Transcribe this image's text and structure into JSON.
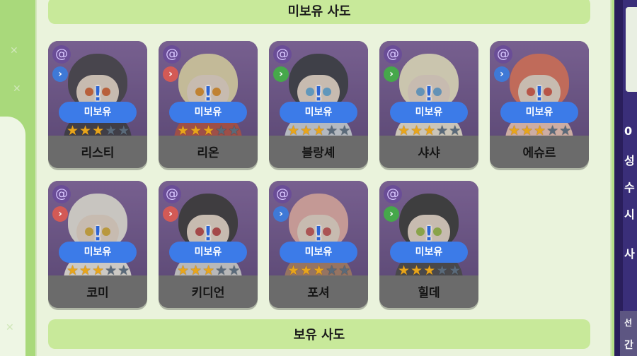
{
  "sections": {
    "unowned_title": "미보유 사도",
    "owned_title": "보유 사도"
  },
  "colors": {
    "badge_blue": "#3c7be8",
    "star_gold": "#e8a51b",
    "card_purple": "#6a4e8f"
  },
  "cards": [
    {
      "name": "리스티",
      "badge": "미보유",
      "stars": 3,
      "class_icon": "chevron-blue",
      "hair": "#3a3540",
      "eyes": "#d45b28",
      "body": "#2e2b38"
    },
    {
      "name": "리온",
      "badge": "미보유",
      "stars": 3,
      "class_icon": "chevron-red",
      "hair": "#e3d7a8",
      "eyes": "#e08a1b",
      "body": "#b1433a"
    },
    {
      "name": "블랑셰",
      "badge": "미보유",
      "stars": 3,
      "class_icon": "chevron-green",
      "hair": "#2d2e3a",
      "eyes": "#5ba7d8",
      "body": "#cfd6e0"
    },
    {
      "name": "샤샤",
      "badge": "미보유",
      "stars": 3,
      "class_icon": "chevron-green",
      "hair": "#eee6c6",
      "eyes": "#5fa0d1",
      "body": "#efe7d4"
    },
    {
      "name": "에슈르",
      "badge": "미보유",
      "stars": 3,
      "class_icon": "chevron-blue",
      "hair": "#e06a53",
      "eyes": "#d34b3a",
      "body": "#f1c5b8"
    },
    {
      "name": "코미",
      "badge": "미보유",
      "stars": 3,
      "class_icon": "chevron-red",
      "hair": "#ebe7e0",
      "eyes": "#d6a82c",
      "body": "#f0ece5"
    },
    {
      "name": "키디언",
      "badge": "미보유",
      "stars": 3,
      "class_icon": "chevron-red",
      "hair": "#2d2a2f",
      "eyes": "#b93b3b",
      "body": "#d4d4d6"
    },
    {
      "name": "포셔",
      "badge": "미보유",
      "stars": 3,
      "class_icon": "chevron-blue",
      "hair": "#e5a9a4",
      "eyes": "#c24a4a",
      "body": "#a6765e"
    },
    {
      "name": "힐데",
      "badge": "미보유",
      "stars": 3,
      "class_icon": "chevron-green",
      "hair": "#2c2b2d",
      "eyes": "#94b83c",
      "body": "#3b3a3e"
    }
  ],
  "right_panel_text": [
    "성",
    "수",
    "시",
    "사",
    "0",
    "간",
    "선"
  ]
}
